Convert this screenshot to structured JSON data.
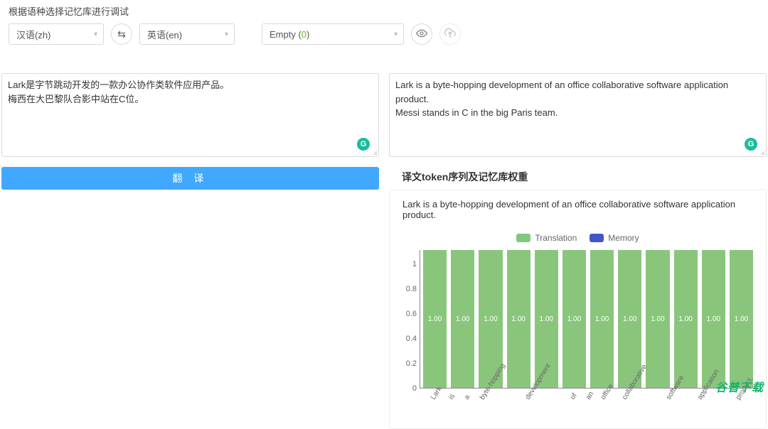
{
  "header": {
    "label": "根据语种选择记忆库进行调试",
    "source_lang": "汉语(zh)",
    "target_lang": "英语(en)",
    "empty_prefix": "Empty (",
    "empty_count": "0",
    "empty_suffix": ")"
  },
  "source": {
    "text": "Lark是字节跳动开发的一款办公协作类软件应用产品。\n梅西在大巴黎队合影中站在C位。"
  },
  "target": {
    "text": "Lark is a byte-hopping development of an office collaborative software application product.\nMessi stands in C in the big Paris team."
  },
  "translate_button": "翻 译",
  "grammarly_badge": "G",
  "subheading": "译文token序列及记忆库权重",
  "chart_sentence": "Lark is a byte-hopping development of an office collaborative software application product.",
  "legend": {
    "translation": "Translation",
    "memory": "Memory"
  },
  "watermark": "谷普下载",
  "chart_data": {
    "type": "bar",
    "categories": [
      "Lark",
      "is",
      "a",
      "byte-hopping",
      "development",
      "of",
      "an",
      "office",
      "collaborative",
      "software",
      "application",
      "product."
    ],
    "series": [
      {
        "name": "Translation",
        "values": [
          1.0,
          1.0,
          1.0,
          1.0,
          1.0,
          1.0,
          1.0,
          1.0,
          1.0,
          1.0,
          1.0,
          1.0
        ]
      },
      {
        "name": "Memory",
        "values": [
          0,
          0,
          0,
          0,
          0,
          0,
          0,
          0,
          0,
          0,
          0,
          0
        ]
      }
    ],
    "ylim": [
      0,
      1
    ],
    "yticks": [
      0,
      0.2,
      0.4,
      0.6,
      0.8,
      1
    ],
    "title": "",
    "xlabel": "",
    "ylabel": ""
  }
}
